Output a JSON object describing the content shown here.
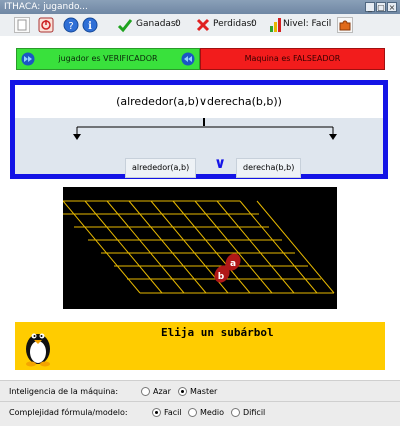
{
  "window": {
    "title": "ITHACA: jugando..."
  },
  "toolbar": {
    "ganadas_label": "Ganadas:",
    "ganadas_value": "0",
    "perdidas_label": "Perdidas:",
    "perdidas_value": "0",
    "nivel_label": "Nivel: Facil"
  },
  "roles": {
    "verifier_text": "jugador es VERIFICADOR",
    "falsifier_text": "Maquina es FALSEADOR"
  },
  "formula": {
    "main": "(alrededor(a,b)∨derecha(b,b))",
    "left_sub": "alrededor(a,b)",
    "connective": "∨",
    "right_sub": "derecha(b,b)"
  },
  "model": {
    "objects": [
      "a",
      "b"
    ]
  },
  "message": {
    "text": "Elija un subárbol"
  },
  "settings": {
    "intel_label": "Inteligencia de la máquina:",
    "intel_options": [
      "Azar",
      "Master"
    ],
    "intel_selected": "Master",
    "complex_label": "Complejidad fórmula/modelo:",
    "complex_options": [
      "Facil",
      "Medio",
      "Dificil"
    ],
    "complex_selected": "Facil"
  },
  "colors": {
    "green": "#39e13c",
    "red": "#f21c1c",
    "blue_frame": "#1414e6",
    "grid": "#e6b800",
    "message_bg": "#ffcc00"
  }
}
